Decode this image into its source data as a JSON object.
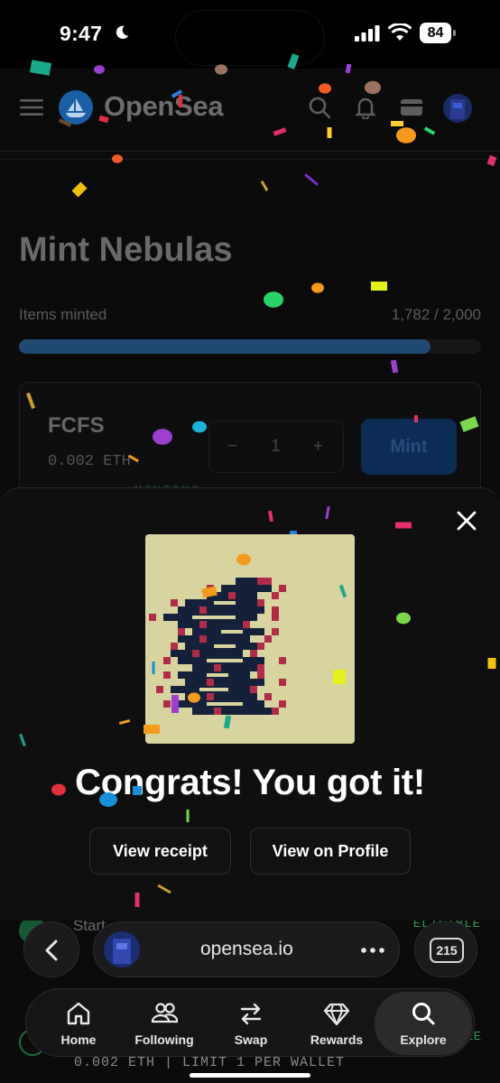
{
  "status_bar": {
    "time": "9:47",
    "battery": "84",
    "icons": [
      "moon-icon",
      "cellular-signal-icon",
      "wifi-icon",
      "battery-icon"
    ]
  },
  "header": {
    "brand": "OpenSea",
    "icons": [
      "menu-icon",
      "opensea-logo",
      "search-icon",
      "bell-icon",
      "wallet-icon",
      "avatar"
    ]
  },
  "collection": {
    "title": "Mint Nebulas",
    "minted_label": "Items minted",
    "minted_count": "1,782 / 2,000",
    "minted_fraction": 0.891
  },
  "stage": {
    "name": "FCFS",
    "price": "0.002 ETH",
    "quantity": "1",
    "minus": "−",
    "plus": "+",
    "mint_label": "Mint",
    "status": "MINTING"
  },
  "stage_bottom": {
    "name": "Start",
    "tag": "ELIGIBLE",
    "price_limit": "0.002 ETH | LIMIT 1 PER WALLET"
  },
  "modal": {
    "title": "Congrats! You got it!",
    "view_receipt": "View receipt",
    "view_profile": "View on Profile"
  },
  "browser": {
    "url": "opensea.io",
    "tab_count": "215"
  },
  "tabbar": {
    "items": [
      {
        "label": "Home",
        "icon": "home-icon"
      },
      {
        "label": "Following",
        "icon": "following-icon"
      },
      {
        "label": "Swap",
        "icon": "swap-icon"
      },
      {
        "label": "Rewards",
        "icon": "diamond-icon"
      },
      {
        "label": "Explore",
        "icon": "search-icon",
        "active": true
      }
    ]
  },
  "colors": {
    "background": "#000000",
    "sheet": "#0f0f10",
    "nft_background": "#d8d49f",
    "nft_dark": "#15213a",
    "nft_red": "#b02d4a",
    "progress": "#204a72",
    "eligible": "#2c9a4e"
  }
}
